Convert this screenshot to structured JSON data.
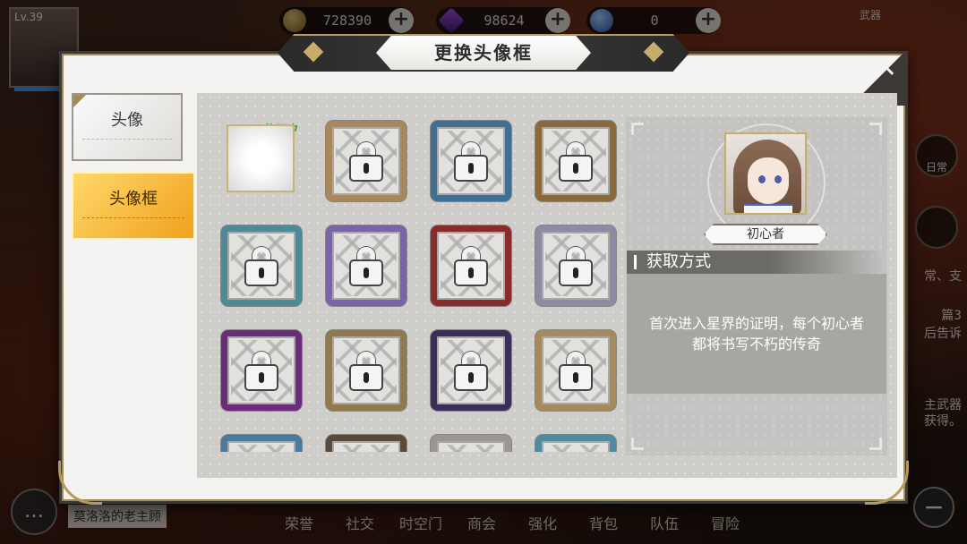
{
  "hud": {
    "level": "Lv.39",
    "currencies": [
      {
        "name": "gold",
        "value": "728390"
      },
      {
        "name": "gem",
        "value": "98624"
      },
      {
        "name": "orb",
        "value": "0"
      }
    ],
    "top_right_label": "武器",
    "side_texts": [
      "常、支",
      "篇3",
      "后告诉",
      "主武器",
      "获得。"
    ],
    "side_button_label": "日常"
  },
  "bottom_nav": [
    "荣誉",
    "社交",
    "时空门",
    "商会",
    "强化",
    "背包",
    "队伍",
    "冒险"
  ],
  "chat": {
    "name": "莫洛洛的老主顾"
  },
  "dialog": {
    "title": "更换头像框",
    "close": "✕",
    "tabs": [
      {
        "label": "头像",
        "selected": false
      },
      {
        "label": "头像框",
        "selected": true
      }
    ],
    "in_use_label": "使用中",
    "frames": [
      {
        "id": "current",
        "locked": false,
        "color": "#c9b27a"
      },
      {
        "id": "f2",
        "locked": true,
        "color": "#a8875a"
      },
      {
        "id": "f3",
        "locked": true,
        "color": "#3e6f94"
      },
      {
        "id": "f4",
        "locked": true,
        "color": "#8a6a3a"
      },
      {
        "id": "f5",
        "locked": true,
        "color": "#4c8a98"
      },
      {
        "id": "f6",
        "locked": true,
        "color": "#7a64a8"
      },
      {
        "id": "f7",
        "locked": true,
        "color": "#8a2a2a"
      },
      {
        "id": "f8",
        "locked": true,
        "color": "#8f8aa3"
      },
      {
        "id": "f9",
        "locked": true,
        "color": "#6a2c7a"
      },
      {
        "id": "f10",
        "locked": true,
        "color": "#8f7a4e"
      },
      {
        "id": "f11",
        "locked": true,
        "color": "#3a2f5a"
      },
      {
        "id": "f12",
        "locked": true,
        "color": "#a58a5e"
      },
      {
        "id": "f13",
        "locked": true,
        "color": "#4b7a9a"
      },
      {
        "id": "f14",
        "locked": true,
        "color": "#5a4a3a"
      },
      {
        "id": "f15",
        "locked": true,
        "color": "#9a9692"
      },
      {
        "id": "f16",
        "locked": true,
        "color": "#4e8aa0"
      }
    ],
    "detail": {
      "frame_name": "初心者",
      "acquire_header": "获取方式",
      "acquire_text": "首次进入星界的证明，每个初心者都将书写不朽的传奇"
    }
  }
}
